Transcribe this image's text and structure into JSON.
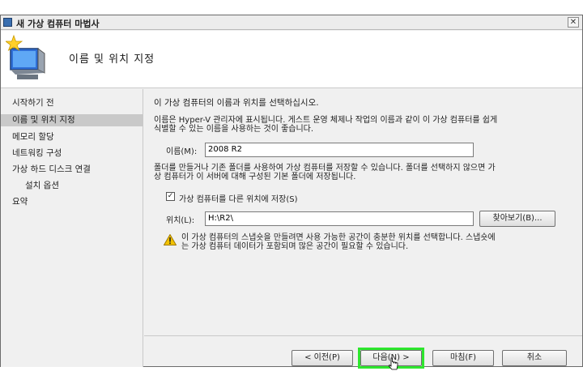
{
  "window": {
    "title": "새 가상 컴퓨터 마법사",
    "close_glyph": "✕",
    "heading": "이름 및 위치 지정"
  },
  "sidebar": {
    "items": [
      {
        "label": "시작하기 전",
        "active": false
      },
      {
        "label": "이름 및 위치 지정",
        "active": true
      },
      {
        "label": "메모리 할당",
        "active": false
      },
      {
        "label": "네트워킹 구성",
        "active": false
      },
      {
        "label": "가상 하드 디스크 연결",
        "active": false
      },
      {
        "label": "설치 옵션",
        "active": false
      },
      {
        "label": "요약",
        "active": false
      }
    ]
  },
  "main": {
    "intro": "이 가상 컴퓨터의 이름과 위치를 선택하십시오.",
    "name_help_1": "이름은 Hyper-V 관리자에 표시됩니다. 게스트 운영 체제나 작업의 이름과 같이 이 가상 컴퓨터를 쉽게",
    "name_help_2": "식별할 수 있는 이름을 사용하는 것이 좋습니다.",
    "name_label": "이름(M):",
    "name_value": "2008 R2",
    "folder_help_1": "폴더를 만들거나 기존 폴더를 사용하여 가상 컴퓨터를 저장할 수 있습니다. 폴더를 선택하지 않으면 가",
    "folder_help_2": "상 컴퓨터가 이 서버에 대해 구성된 기본 폴더에 저장됩니다.",
    "store_checkbox_label": "가상 컴퓨터를 다른 위치에 저장(S)",
    "store_checked": true,
    "location_label": "위치(L):",
    "location_value": "H:\\R2\\",
    "browse_button": "찾아보기(B)...",
    "warning_1": "이 가상 컴퓨터의 스냅숏을 만들려면 사용 가능한 공간이 충분한 위치를 선택합니다. 스냅숏에",
    "warning_2": "는 가상 컴퓨터 데이터가 포함되며 많은 공간이 필요할 수 있습니다."
  },
  "buttons": {
    "previous": "< 이전(P)",
    "next": "다음(N) >",
    "finish": "마침(F)",
    "cancel": "취소"
  },
  "icons": {
    "app": "window-app-icon",
    "wizard": "monitor-star-icon",
    "warning": "warning-triangle-icon"
  },
  "colors": {
    "highlight": "#2ee62e",
    "active_nav": "#c9c9c9",
    "warning": "#f2c200"
  }
}
